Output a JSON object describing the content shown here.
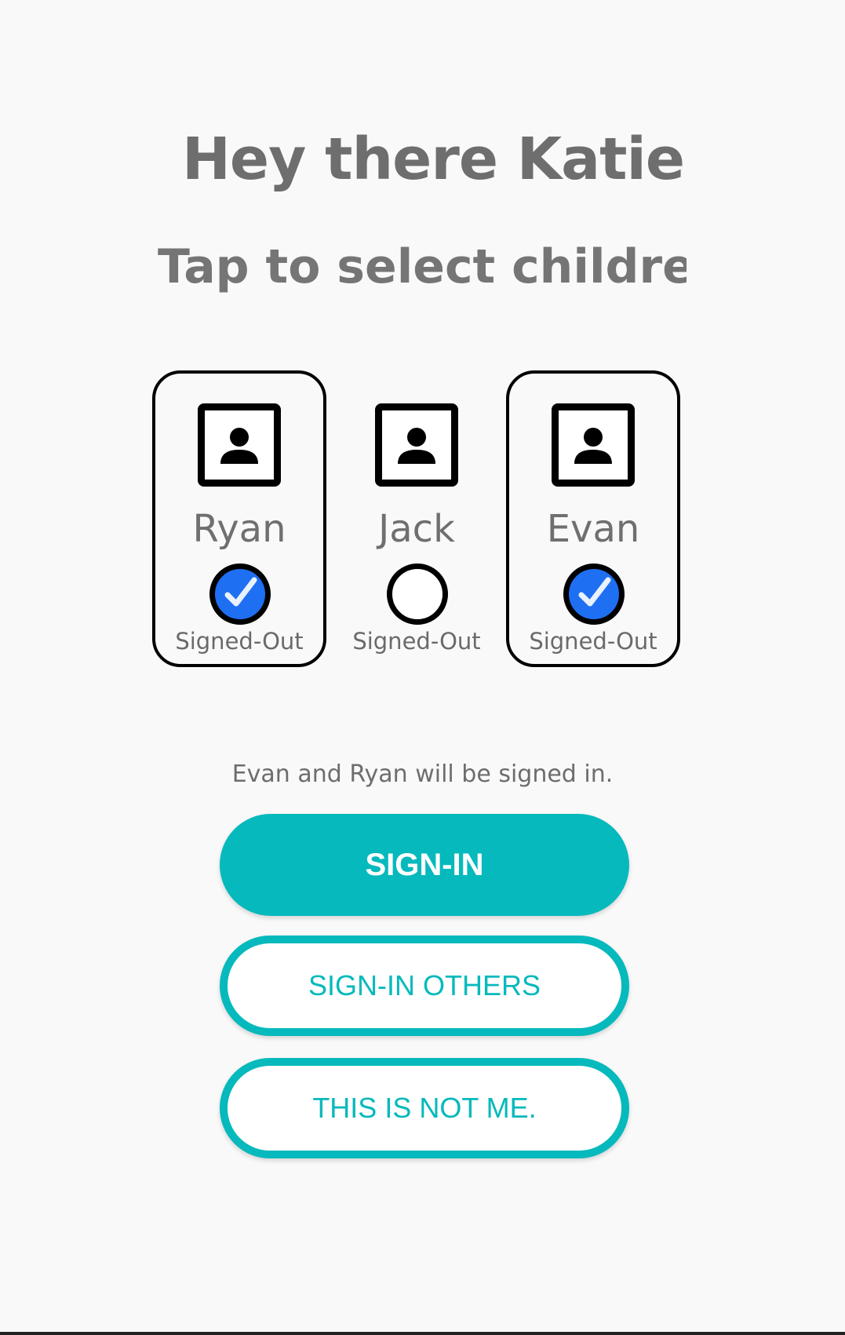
{
  "header": {
    "greeting": "Hey there Katie",
    "subtitle": "Tap to select children"
  },
  "children": [
    {
      "name": "Ryan",
      "status": "Signed-Out",
      "selected": true,
      "avatar_icon": "person-portrait-icon",
      "check_icon": "checkmark-icon"
    },
    {
      "name": "Jack",
      "status": "Signed-Out",
      "selected": false,
      "avatar_icon": "person-portrait-icon",
      "check_icon": "empty-circle-icon"
    },
    {
      "name": "Evan",
      "status": "Signed-Out",
      "selected": true,
      "avatar_icon": "person-portrait-icon",
      "check_icon": "checkmark-icon"
    }
  ],
  "summary": "Evan and Ryan will be signed in.",
  "buttons": {
    "sign_in": "SIGN-IN",
    "sign_in_others": "SIGN-IN OTHERS",
    "not_me": "THIS IS NOT ME."
  },
  "colors": {
    "accent": "#06b9bc",
    "check_selected": "#1e6ff2",
    "text_gray": "#6e6e6e",
    "background": "#f9f9f9"
  }
}
